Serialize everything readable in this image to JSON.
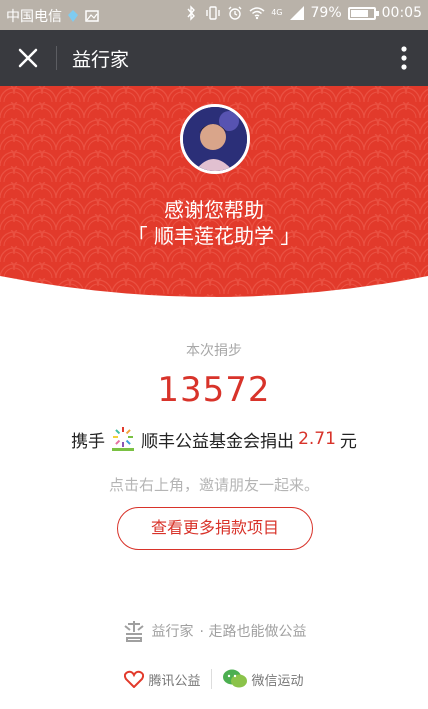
{
  "status_bar": {
    "carrier": "中国电信",
    "network": "4G",
    "battery_percent": "79%",
    "battery_level": 0.79,
    "time": "00:05"
  },
  "nav": {
    "title": "益行家"
  },
  "banner": {
    "thanks_text": "感谢您帮助",
    "project_name": "「 顺丰莲花助学 」",
    "background_color": "#e23a2b"
  },
  "steps": {
    "label": "本次捐步",
    "value": "13572"
  },
  "donation": {
    "prefix": "携手",
    "foundation_text": "顺丰公益基金会捐出",
    "amount": "2.71",
    "unit": "元"
  },
  "invite_text": "点击右上角，邀请朋友一起来。",
  "more_button_label": "查看更多捐款项目",
  "footer": {
    "brand_name": "益行家",
    "slogan": "· 走路也能做公益",
    "tencent_label": "腾讯公益",
    "wechat_sport_label": "微信运动"
  },
  "colors": {
    "accent": "#d8332a",
    "nav_bg": "#393a3f"
  }
}
